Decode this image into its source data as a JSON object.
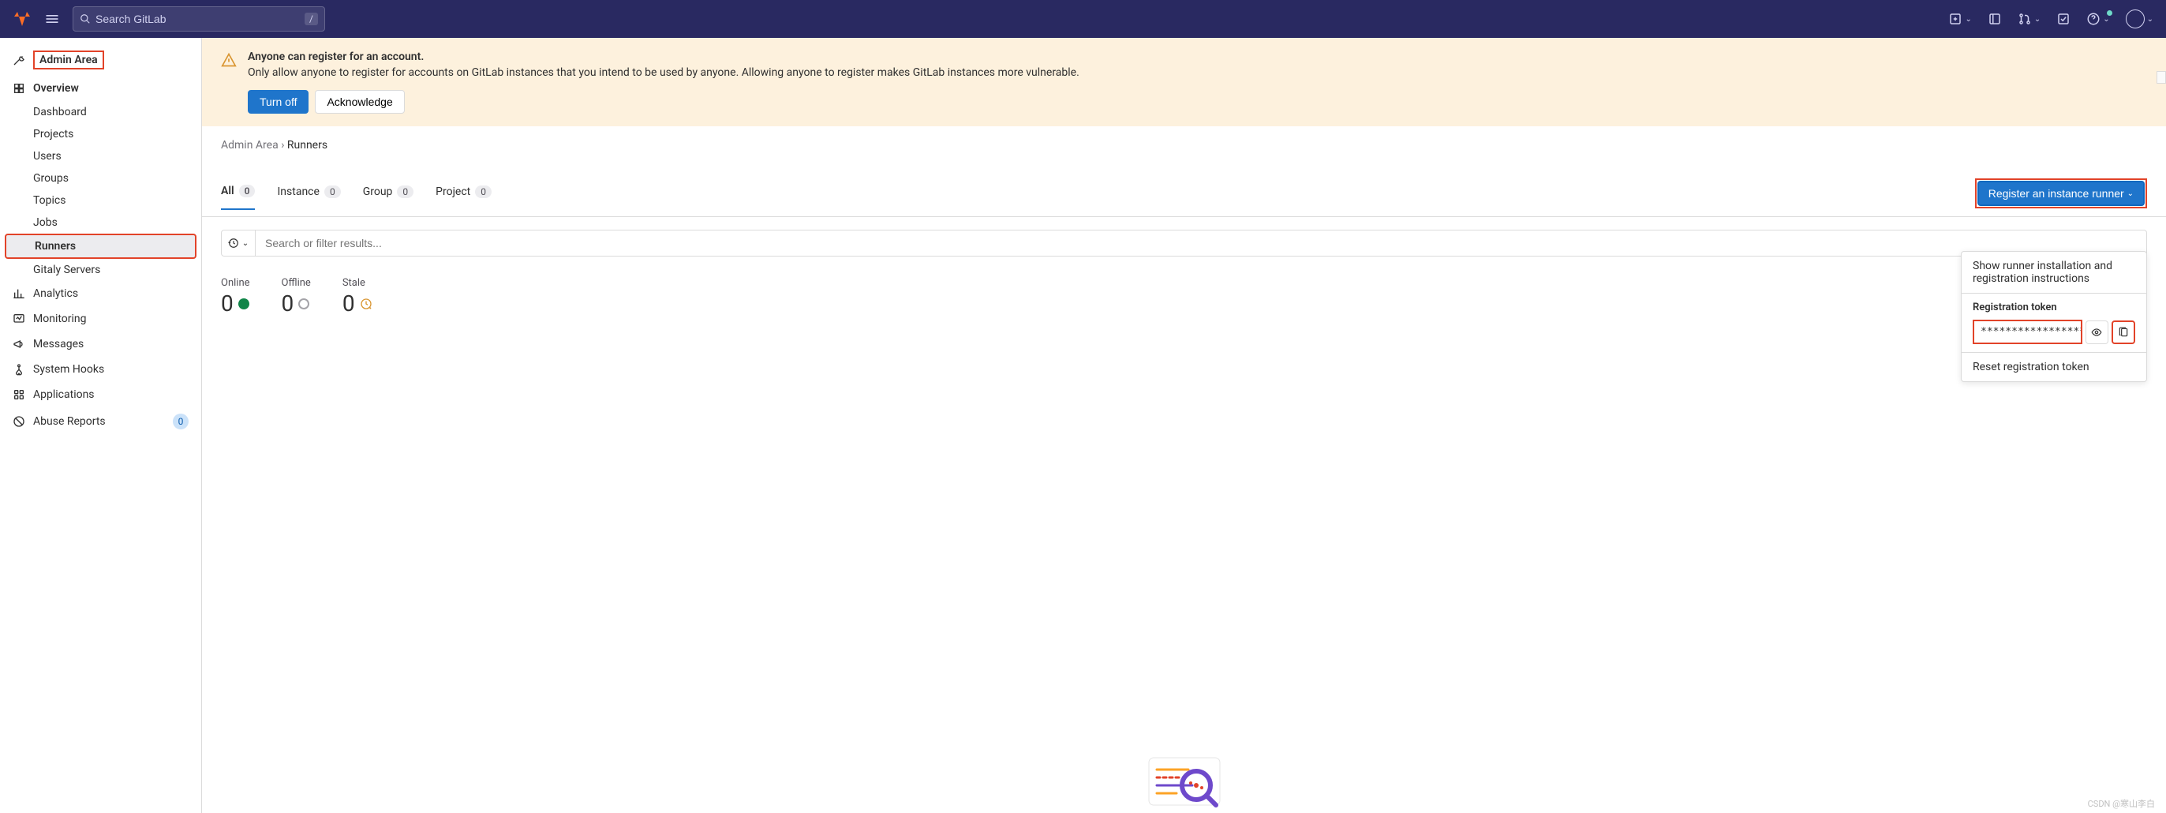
{
  "header": {
    "search_placeholder": "Search GitLab",
    "search_shortcut": "/"
  },
  "sidebar": {
    "title": "Admin Area",
    "sections": [
      {
        "label": "Overview"
      }
    ],
    "overview_items": [
      {
        "label": "Dashboard"
      },
      {
        "label": "Projects"
      },
      {
        "label": "Users"
      },
      {
        "label": "Groups"
      },
      {
        "label": "Topics"
      },
      {
        "label": "Jobs"
      },
      {
        "label": "Runners"
      },
      {
        "label": "Gitaly Servers"
      }
    ],
    "main_items": [
      {
        "label": "Analytics"
      },
      {
        "label": "Monitoring"
      },
      {
        "label": "Messages"
      },
      {
        "label": "System Hooks"
      },
      {
        "label": "Applications"
      },
      {
        "label": "Abuse Reports",
        "count": "0"
      }
    ]
  },
  "alert": {
    "title": "Anyone can register for an account.",
    "text": "Only allow anyone to register for accounts on GitLab instances that you intend to be used by anyone. Allowing anyone to register makes GitLab instances more vulnerable.",
    "turn_off": "Turn off",
    "acknowledge": "Acknowledge"
  },
  "breadcrumb": {
    "parent": "Admin Area",
    "current": "Runners"
  },
  "tabs": [
    {
      "label": "All",
      "count": "0"
    },
    {
      "label": "Instance",
      "count": "0"
    },
    {
      "label": "Group",
      "count": "0"
    },
    {
      "label": "Project",
      "count": "0"
    }
  ],
  "register_button": "Register an instance runner",
  "filter_placeholder": "Search or filter results...",
  "stats": {
    "online": {
      "label": "Online",
      "value": "0"
    },
    "offline": {
      "label": "Offline",
      "value": "0"
    },
    "stale": {
      "label": "Stale",
      "value": "0"
    }
  },
  "dropdown": {
    "instructions": "Show runner installation and registration instructions",
    "token_label": "Registration token",
    "token_value": "*****************",
    "reset": "Reset registration token"
  },
  "watermark": "CSDN @寒山李白"
}
